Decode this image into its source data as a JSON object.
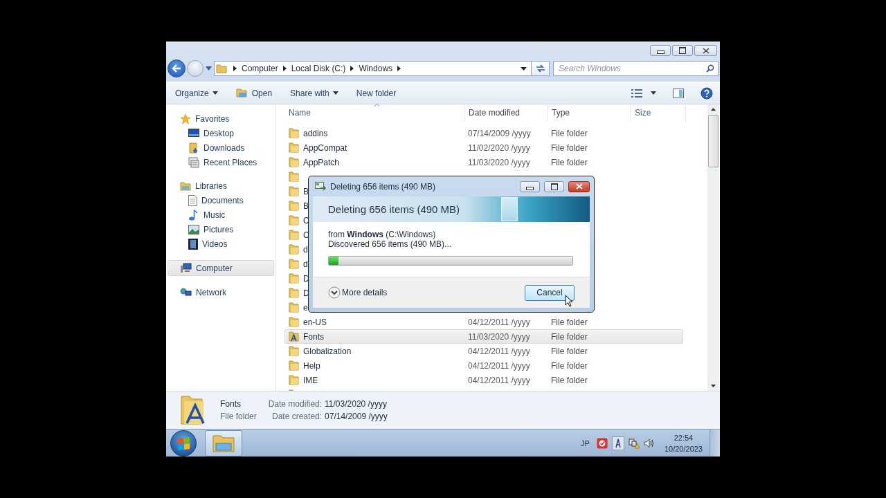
{
  "address": {
    "crumbs": [
      "Computer",
      "Local Disk (C:)",
      "Windows"
    ]
  },
  "search": {
    "placeholder": "Search Windows"
  },
  "toolbar": [
    {
      "label": "Organize",
      "kind": "menu"
    },
    {
      "label": "Open",
      "kind": "icon"
    },
    {
      "label": "Share with",
      "kind": "menu"
    },
    {
      "label": "New folder",
      "kind": "plain"
    }
  ],
  "sidebar": [
    {
      "label": "Favorites",
      "selected": false,
      "children": [
        {
          "label": "Desktop",
          "selected": false
        },
        {
          "label": "Downloads",
          "selected": false
        },
        {
          "label": "Recent Places",
          "selected": false
        }
      ]
    },
    {
      "label": "Libraries",
      "selected": false,
      "children": [
        {
          "label": "Documents",
          "selected": false
        },
        {
          "label": "Music",
          "selected": false
        },
        {
          "label": "Pictures",
          "selected": false
        },
        {
          "label": "Videos",
          "selected": false
        }
      ]
    },
    {
      "label": "Computer",
      "selected": true
    },
    {
      "label": "Network",
      "selected": false
    }
  ],
  "columns": [
    {
      "label": "Name",
      "sorted": true
    },
    {
      "label": "Date modified",
      "sorted": false
    },
    {
      "label": "Type",
      "sorted": false
    },
    {
      "label": "Size",
      "sorted": false
    }
  ],
  "rows": [
    {
      "name": "addins",
      "date": "07/14/2009 /yyyy",
      "type": "File folder",
      "kind": "folder",
      "selected": false
    },
    {
      "name": "AppCompat",
      "date": "11/02/2020 /yyyy",
      "type": "File folder",
      "kind": "folder",
      "selected": false
    },
    {
      "name": "AppPatch",
      "date": "11/03/2020 /yyyy",
      "type": "File folder",
      "kind": "folder",
      "selected": false
    },
    {
      "kind": "folder",
      "selected": false
    },
    {
      "name": "B",
      "kind": "folder",
      "selected": false
    },
    {
      "name": "B",
      "kind": "folder",
      "selected": false
    },
    {
      "name": "C",
      "kind": "folder",
      "selected": false
    },
    {
      "name": "C",
      "kind": "folder",
      "selected": false
    },
    {
      "name": "d",
      "kind": "folder",
      "selected": false
    },
    {
      "name": "d",
      "kind": "folder",
      "selected": false
    },
    {
      "name": "D",
      "kind": "folder",
      "selected": false
    },
    {
      "name": "D",
      "kind": "folder",
      "selected": false
    },
    {
      "name": "e",
      "kind": "folder",
      "selected": false
    },
    {
      "name": "en-US",
      "date": "04/12/2011 /yyyy",
      "type": "File folder",
      "kind": "folder",
      "selected": false
    },
    {
      "name": "Fonts",
      "date": "11/03/2020 /yyyy",
      "type": "File folder",
      "kind": "fonts",
      "selected": true
    },
    {
      "name": "Globalization",
      "date": "04/12/2011 /yyyy",
      "type": "File folder",
      "kind": "folder",
      "selected": false
    },
    {
      "name": "Help",
      "date": "04/12/2011 /yyyy",
      "type": "File folder",
      "kind": "folder",
      "selected": false
    },
    {
      "name": "IME",
      "date": "04/12/2011 /yyyy",
      "type": "File folder",
      "kind": "folder",
      "selected": false
    },
    {
      "kind": "folder",
      "selected": false
    }
  ],
  "details": {
    "name": "Fonts",
    "type": "File folder",
    "fields": [
      {
        "label": "Date modified:",
        "value": "11/03/2020 /yyyy"
      },
      {
        "label": "Date created:",
        "value": "07/14/2009 /yyyy"
      }
    ]
  },
  "dialog": {
    "title": "Deleting 656 items (490 MB)",
    "heading": "Deleting 656 items (490 MB)",
    "source": "from **Windows** (C:\\Windows)",
    "status": "Discovered 656 items (490 MB)...",
    "level": 0.04,
    "details_toggle": "More details",
    "button": "Cancel"
  },
  "taskbar": {
    "language": "JP",
    "time": "22:54",
    "date": "10/20/2023"
  }
}
